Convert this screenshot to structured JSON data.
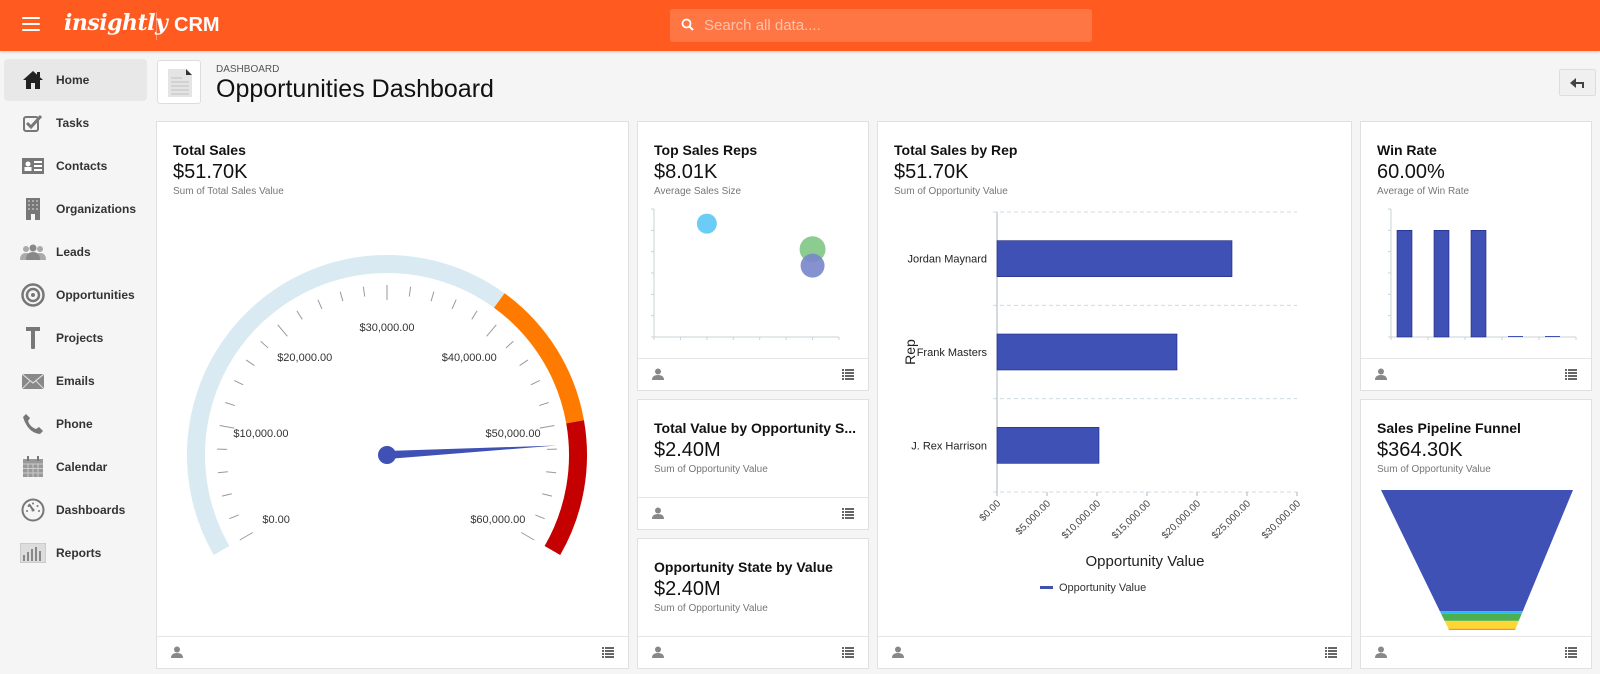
{
  "topbar": {
    "menu_icon": "hamburger-icon",
    "logo": "insightly",
    "app_name": "CRM",
    "search": {
      "placeholder": "Search all data....",
      "value": "",
      "icon": "search-icon"
    },
    "brand_color": "#ff5a1f"
  },
  "sidebar": {
    "items": [
      {
        "label": "Home",
        "icon": "home-icon",
        "active": true
      },
      {
        "label": "Tasks",
        "icon": "tasks-icon",
        "active": false
      },
      {
        "label": "Contacts",
        "icon": "contacts-icon",
        "active": false
      },
      {
        "label": "Organizations",
        "icon": "building-icon",
        "active": false
      },
      {
        "label": "Leads",
        "icon": "leads-icon",
        "active": false
      },
      {
        "label": "Opportunities",
        "icon": "target-icon",
        "active": false
      },
      {
        "label": "Projects",
        "icon": "hammer-icon",
        "active": false
      },
      {
        "label": "Emails",
        "icon": "envelope-icon",
        "active": false
      },
      {
        "label": "Phone",
        "icon": "phone-icon",
        "active": false
      },
      {
        "label": "Calendar",
        "icon": "calendar-icon",
        "active": false
      },
      {
        "label": "Dashboards",
        "icon": "speedometer-icon",
        "active": false
      },
      {
        "label": "Reports",
        "icon": "bar-chart-icon",
        "active": false
      }
    ]
  },
  "header": {
    "breadcrumb": "DASHBOARD",
    "title": "Opportunities Dashboard",
    "back_icon": "back-arrow-icon"
  },
  "cards": {
    "total_sales": {
      "title": "Total Sales",
      "value": "$51.70K",
      "subtitle": "Sum of Total Sales Value"
    },
    "top_sales_reps": {
      "title": "Top Sales Reps",
      "value": "$8.01K",
      "subtitle": "Average Sales Size"
    },
    "total_value_by_stage": {
      "title": "Total Value by Opportunity S...",
      "value": "$2.40M",
      "subtitle": "Sum of Opportunity Value"
    },
    "opportunity_state": {
      "title": "Opportunity State by Value",
      "value": "$2.40M",
      "subtitle": "Sum of Opportunity Value"
    },
    "total_sales_by_rep": {
      "title": "Total Sales by Rep",
      "value": "$51.70K",
      "subtitle": "Sum of Opportunity Value"
    },
    "win_rate": {
      "title": "Win Rate",
      "value": "60.00%",
      "subtitle": "Average of Win Rate"
    },
    "pipeline_funnel": {
      "title": "Sales Pipeline Funnel",
      "value": "$364.30K",
      "subtitle": "Sum of Opportunity Value"
    }
  },
  "chart_data": [
    {
      "id": "gauge",
      "type": "gauge",
      "title": "Total Sales",
      "value": 51700,
      "range": [
        0,
        60000
      ],
      "tick_labels": [
        "$0.00",
        "$10,000.00",
        "$20,000.00",
        "$30,000.00",
        "$40,000.00",
        "$50,000.00",
        "$60,000.00"
      ],
      "major_step": 10000,
      "minor_step": 2000,
      "bands": [
        {
          "from": 0,
          "to": 39000,
          "color": "#d9eaf3"
        },
        {
          "from": 39000,
          "to": 50000,
          "color": "#ff7b00"
        },
        {
          "from": 50000,
          "to": 60000,
          "color": "#c40000"
        }
      ],
      "needle_color": "#3f51b5"
    },
    {
      "id": "bubble",
      "type": "scatter",
      "title": "Top Sales Reps",
      "points": [
        {
          "x": 2,
          "y": 6.2,
          "size": 1.0,
          "color": "#5bc8f5"
        },
        {
          "x": 6,
          "y": 4.8,
          "size": 1.3,
          "color": "#81c784"
        },
        {
          "x": 6,
          "y": 3.9,
          "size": 1.2,
          "color": "#7986cb"
        }
      ],
      "xlim": [
        0,
        7
      ],
      "ylim": [
        0,
        7
      ]
    },
    {
      "id": "bar_by_rep",
      "type": "bar",
      "orientation": "horizontal",
      "title": "Total Sales by Rep",
      "categories": [
        "Jordan Maynard",
        "Frank Masters",
        "J. Rex Harrison"
      ],
      "values": [
        23500,
        18000,
        10200
      ],
      "xlabel": "Opportunity Value",
      "ylabel": "Rep",
      "xlim": [
        0,
        30000
      ],
      "tick_labels": [
        "$0.00",
        "$5,000.00",
        "$10,000.00",
        "$15,000.00",
        "$20,000.00",
        "$25,000.00",
        "$30,000.00"
      ],
      "legend": [
        "Opportunity Value"
      ],
      "legend_position": "bottom",
      "color": "#3f51b5",
      "grid": true
    },
    {
      "id": "win_rate",
      "type": "bar",
      "title": "Win Rate",
      "values": [
        100,
        100,
        100,
        0,
        0
      ],
      "ylim": [
        0,
        120
      ],
      "color": "#3f51b5"
    },
    {
      "id": "funnel",
      "type": "funnel",
      "title": "Sales Pipeline Funnel",
      "stages": [
        {
          "share": 0.865,
          "color": "#3f51b5"
        },
        {
          "share": 0.02,
          "color": "#29b6f6"
        },
        {
          "share": 0.05,
          "color": "#4caf50"
        },
        {
          "share": 0.055,
          "color": "#fdd835"
        },
        {
          "share": 0.01,
          "color": "#ff9800"
        }
      ]
    }
  ]
}
